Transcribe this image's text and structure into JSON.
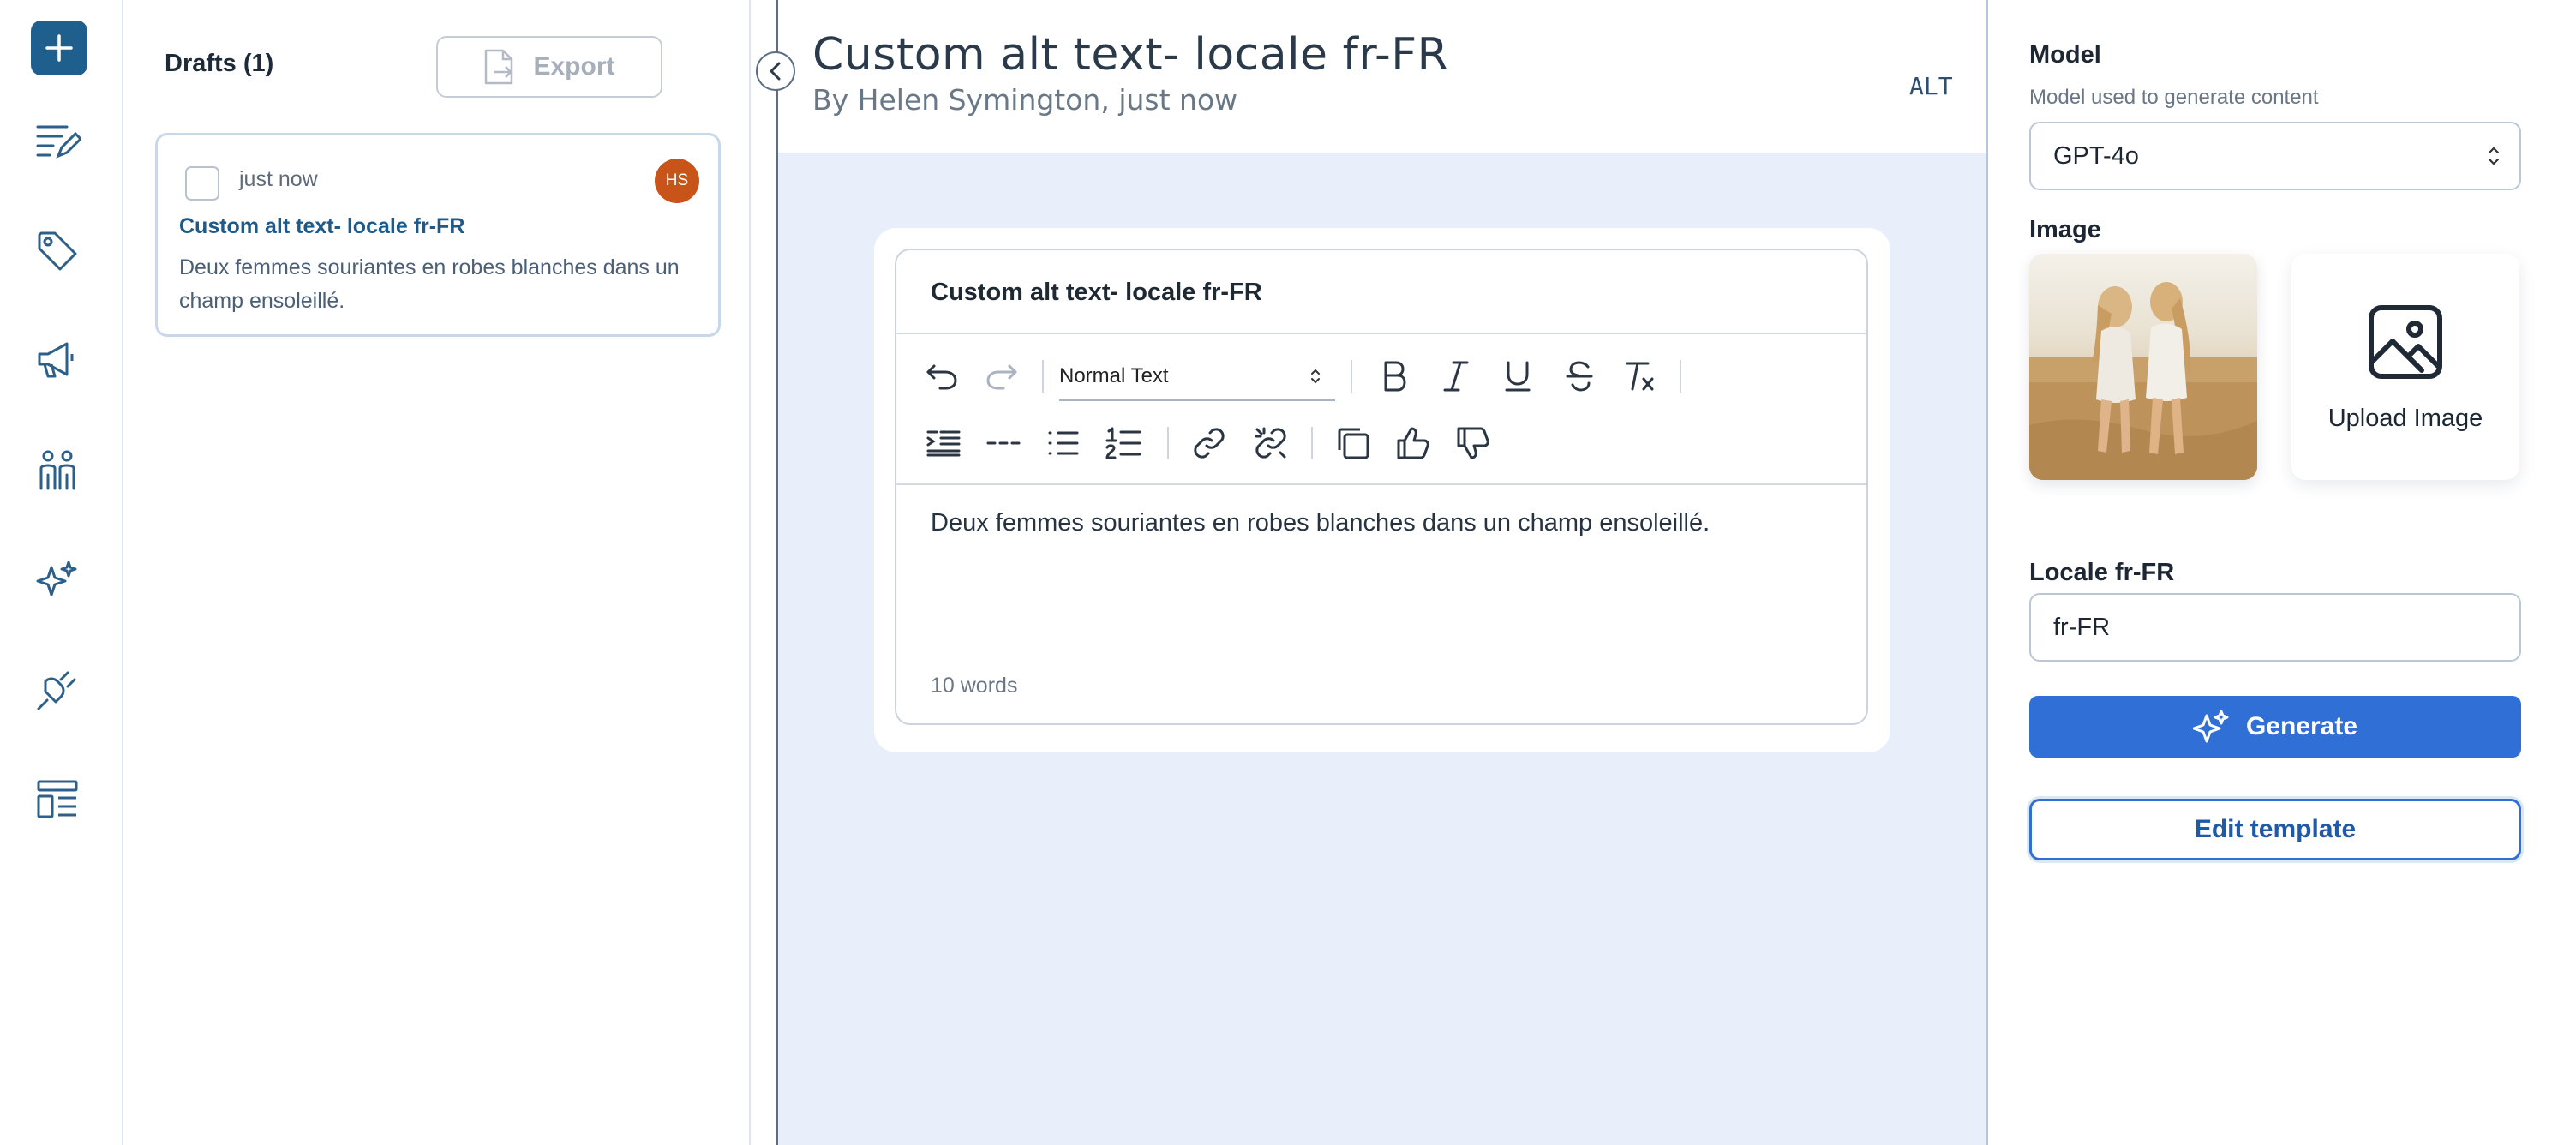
{
  "rail": {
    "items": [
      {
        "icon": "new-plus-icon"
      },
      {
        "icon": "content-list-icon"
      },
      {
        "icon": "tag-icon"
      },
      {
        "icon": "megaphone-icon"
      },
      {
        "icon": "people-icon"
      },
      {
        "icon": "sparkles-icon"
      },
      {
        "icon": "plug-icon"
      },
      {
        "icon": "template-layout-icon"
      }
    ]
  },
  "drafts": {
    "title": "Drafts (1)",
    "export_label": "Export",
    "items": [
      {
        "time": "just now",
        "avatar": "HS",
        "title": "Custom alt text- locale fr-FR",
        "body": "Deux femmes souriantes en robes blanches dans un champ ensoleillé."
      }
    ]
  },
  "document": {
    "title": "Custom alt text- locale fr-FR",
    "byline": "By Helen Symington, just now",
    "tag": "ALT"
  },
  "editor": {
    "title": "Custom alt text- locale fr-FR",
    "text_style": "Normal Text",
    "body": "Deux femmes souriantes en robes blanches dans un champ ensoleillé.",
    "word_count": "10 words",
    "toolbar_icons": [
      "undo-icon",
      "redo-icon",
      "bold-icon",
      "italic-icon",
      "underline-icon",
      "strikethrough-icon",
      "clear-format-icon",
      "outdent-icon",
      "horizontal-rule-icon",
      "bullet-list-icon",
      "numbered-list-icon",
      "link-icon",
      "unlink-icon",
      "copy-icon",
      "thumbs-up-icon",
      "thumbs-down-icon"
    ]
  },
  "settings": {
    "model_label": "Model",
    "model_help": "Model used to generate content",
    "model_value": "GPT-4o",
    "image_label": "Image",
    "upload_label": "Upload Image",
    "locale_label": "Locale fr-FR",
    "locale_value": "fr-FR",
    "generate_label": "Generate",
    "edit_template_label": "Edit template"
  },
  "colors": {
    "brand": "#1f5f8e",
    "primary_button": "#2f6fd6",
    "avatar": "#c9541a",
    "canvas": "#e9eefb"
  }
}
